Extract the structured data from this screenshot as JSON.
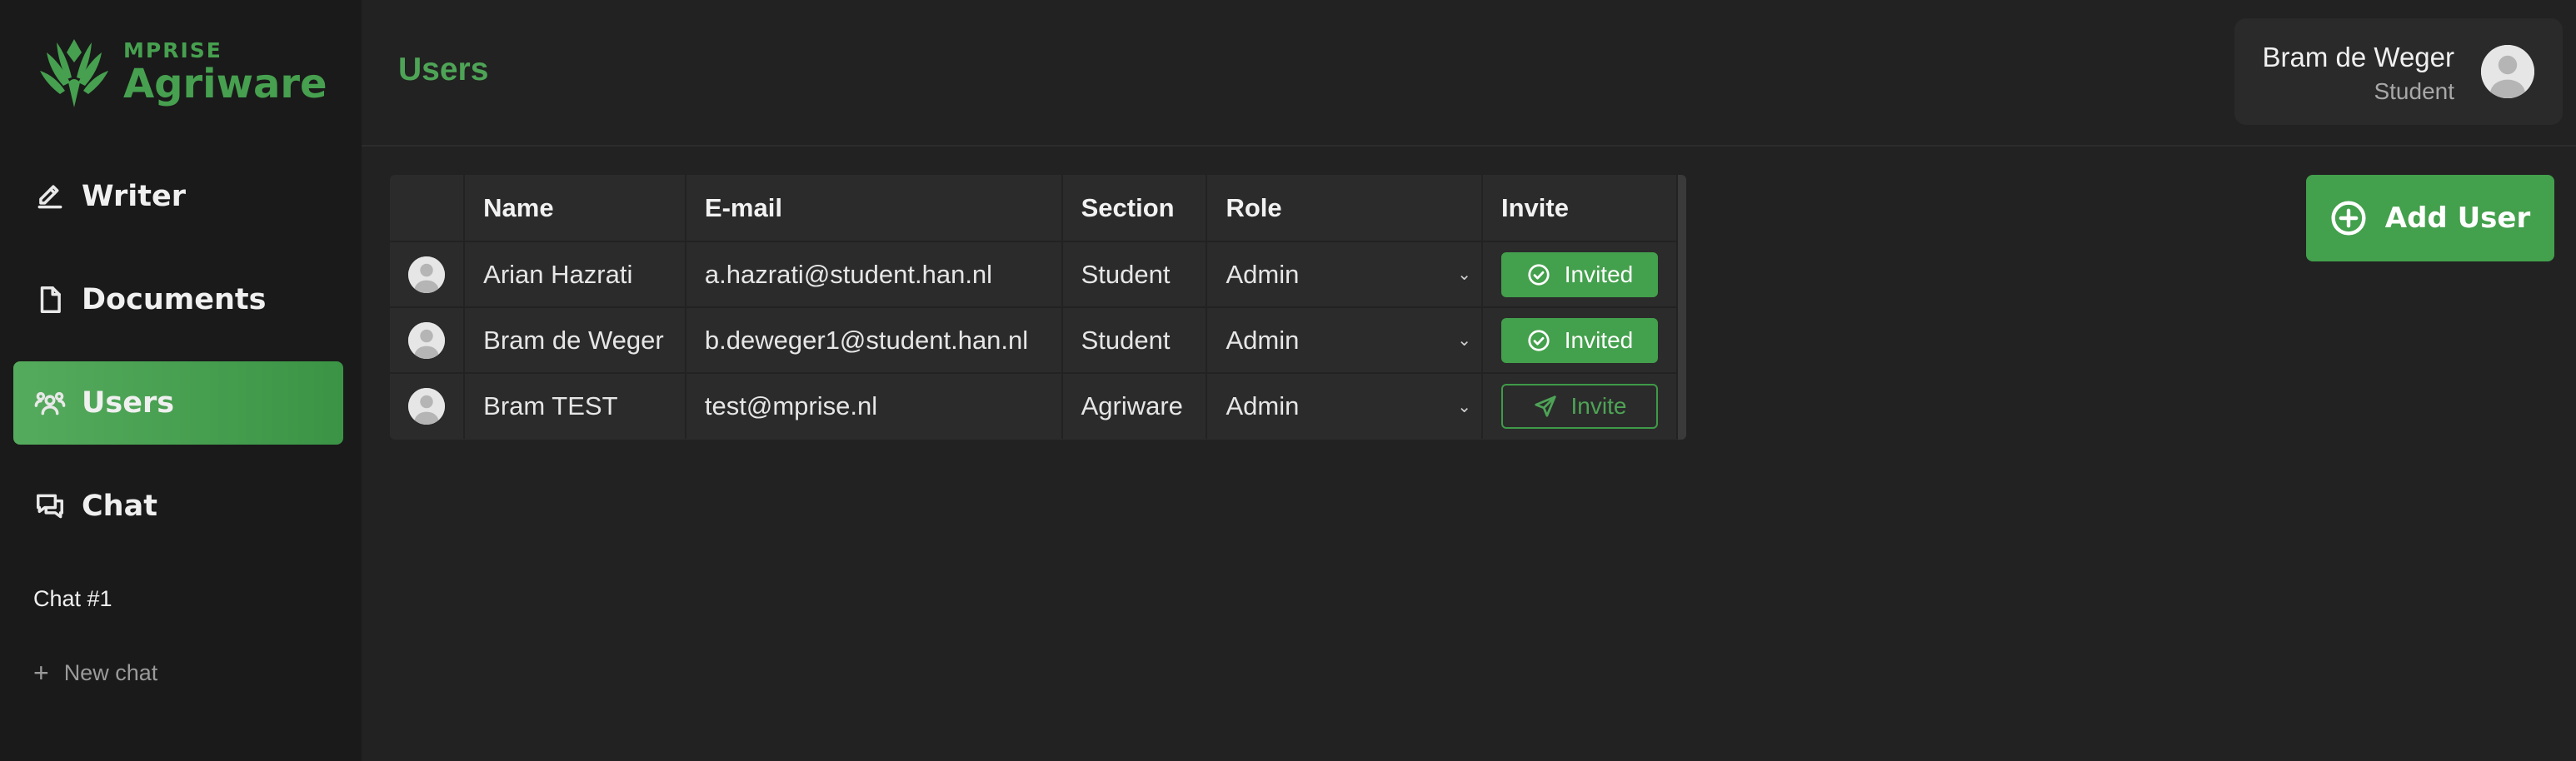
{
  "app": {
    "logo_small": "MPRISE",
    "logo_big": "Agriware",
    "brand_color": "#43a04c"
  },
  "sidebar": {
    "items": [
      {
        "label": "Writer",
        "icon": "pencil-icon",
        "active": false
      },
      {
        "label": "Documents",
        "icon": "document-icon",
        "active": false
      },
      {
        "label": "Users",
        "icon": "users-icon",
        "active": true
      },
      {
        "label": "Chat",
        "icon": "chat-icon",
        "active": false
      }
    ],
    "chats": [
      {
        "label": "Chat #1"
      }
    ],
    "new_chat_label": "New chat"
  },
  "header": {
    "title": "Users",
    "user": {
      "name": "Bram de Weger",
      "role": "Student"
    }
  },
  "table": {
    "columns": [
      "",
      "Name",
      "E-mail",
      "Section",
      "Role",
      "Invite"
    ],
    "rows": [
      {
        "name": "Arian Hazrati",
        "email": "a.hazrati@student.han.nl",
        "section": "Student",
        "role": "Admin",
        "invite": "Invited",
        "invite_state": "invited"
      },
      {
        "name": "Bram de Weger",
        "email": "b.deweger1@student.han.nl",
        "section": "Student",
        "role": "Admin",
        "invite": "Invited",
        "invite_state": "invited"
      },
      {
        "name": "Bram TEST",
        "email": "test@mprise.nl",
        "section": "Agriware",
        "role": "Admin",
        "invite": "Invite",
        "invite_state": "pending"
      }
    ]
  },
  "actions": {
    "add_user_label": "Add User"
  }
}
